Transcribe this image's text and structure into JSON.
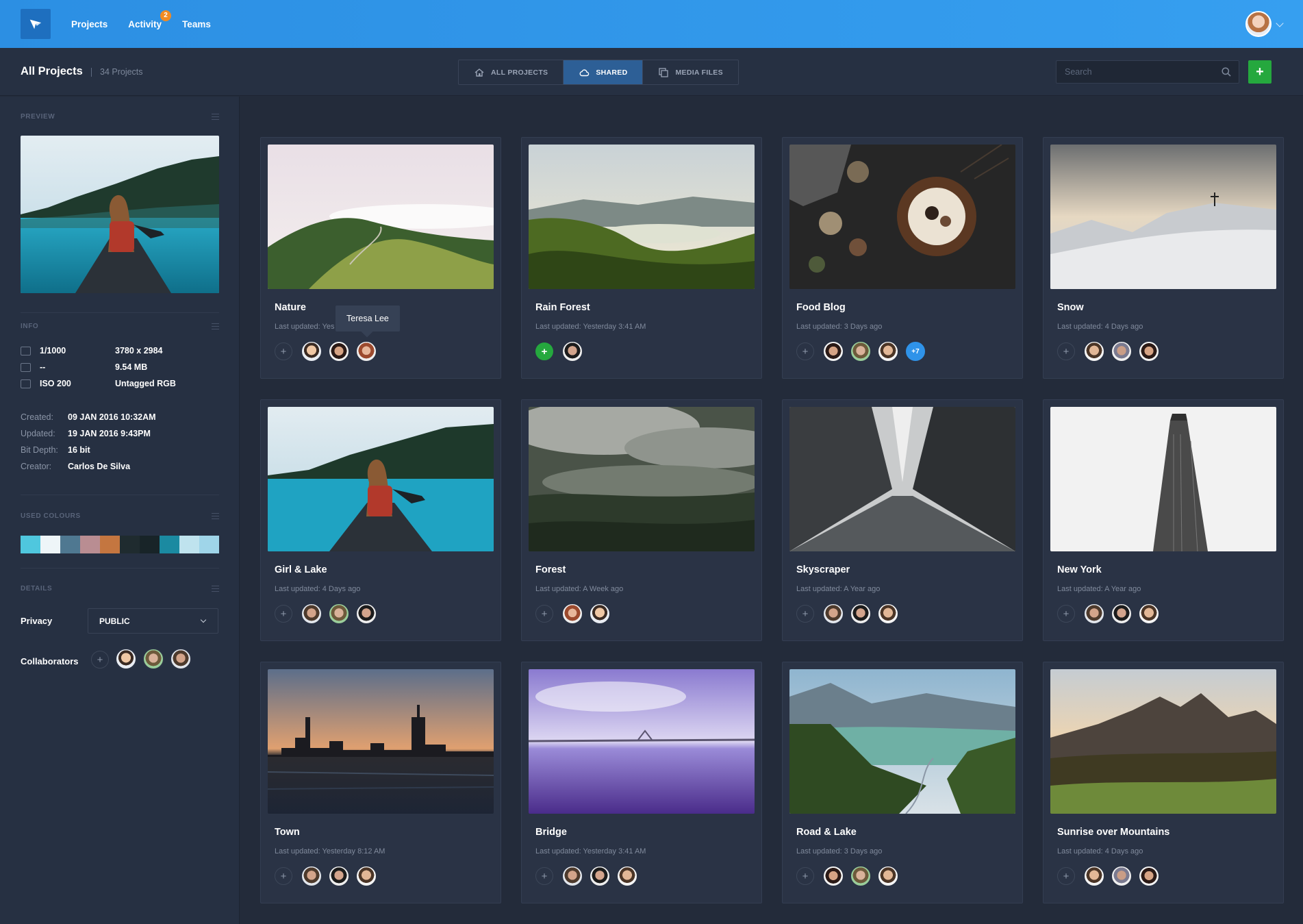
{
  "nav": {
    "items": [
      {
        "label": "Projects",
        "badge": null
      },
      {
        "label": "Activity",
        "badge": "2"
      },
      {
        "label": "Teams",
        "badge": null
      }
    ]
  },
  "header": {
    "title": "All Projects",
    "count": "34 Projects",
    "tabs": [
      {
        "label": "ALL PROJECTS",
        "icon": "home-icon",
        "active": false
      },
      {
        "label": "SHARED",
        "icon": "cloud-icon",
        "active": true
      },
      {
        "label": "MEDIA FILES",
        "icon": "media-files-icon",
        "active": false
      }
    ],
    "search_placeholder": "Search",
    "add_label": "+"
  },
  "sidebar": {
    "preview_heading": "PREVIEW",
    "info_heading": "INFO",
    "info": [
      {
        "icon": "shutter-icon",
        "a": "1/1000",
        "b": "3780 x 2984"
      },
      {
        "icon": "aperture-icon",
        "a": "--",
        "b": "9.54 MB"
      },
      {
        "icon": "iso-icon",
        "a": "ISO 200",
        "b": "Untagged RGB"
      }
    ],
    "meta": [
      {
        "k": "Created:",
        "v": "09 JAN 2016 10:32AM"
      },
      {
        "k": "Updated:",
        "v": "19 JAN 2016 9:43PM"
      },
      {
        "k": "Bit Depth:",
        "v": "16 bit"
      },
      {
        "k": "Creator:",
        "v": "Carlos De Silva"
      }
    ],
    "colours_heading": "USED COLOURS",
    "colours": [
      "#4fc7de",
      "#eef5f8",
      "#4f7891",
      "#b98d92",
      "#c47640",
      "#1f2b2f",
      "#182428",
      "#1b8aa1",
      "#bfe3ee",
      "#9fd5e9"
    ],
    "details_heading": "DETAILS",
    "privacy_label": "Privacy",
    "privacy_value": "PUBLIC",
    "collaborators_label": "Collaborators",
    "collaborator_add": "+"
  },
  "projects": [
    {
      "title": "Nature",
      "updated": "Last updated: Yes",
      "scene": "nature",
      "add": "+",
      "avatars": [
        "av-a",
        "av-b",
        "av-c"
      ],
      "tooltip": "Teresa Lee"
    },
    {
      "title": "Rain Forest",
      "updated": "Last updated: Yesterday 3:41 AM",
      "scene": "rainforest",
      "add": "+",
      "add_green": true,
      "avatars": [
        "av-h"
      ]
    },
    {
      "title": "Food Blog",
      "updated": "Last updated: 3 Days ago",
      "scene": "food",
      "add": "+",
      "avatars": [
        "av-b",
        "av-e",
        "av-f"
      ],
      "more": "+7"
    },
    {
      "title": "Snow",
      "updated": "Last updated: 4 Days ago",
      "scene": "snow",
      "add": "+",
      "avatars": [
        "av-f",
        "av-g",
        "av-b"
      ]
    },
    {
      "title": "Girl & Lake",
      "updated": "Last updated: 4 Days ago",
      "scene": "lake",
      "add": "+",
      "avatars": [
        "av-d",
        "av-e",
        "av-h"
      ]
    },
    {
      "title": "Forest",
      "updated": "Last updated: A Week ago",
      "scene": "forest",
      "add": "+",
      "avatars": [
        "av-c",
        "av-a"
      ]
    },
    {
      "title": "Skyscraper",
      "updated": "Last updated: A Year ago",
      "scene": "skyscraper",
      "add": "+",
      "avatars": [
        "av-d",
        "av-h",
        "av-f"
      ]
    },
    {
      "title": "New York",
      "updated": "Last updated: A Year ago",
      "scene": "newyork",
      "add": "+",
      "avatars": [
        "av-d",
        "av-h",
        "av-f"
      ]
    },
    {
      "title": "Town",
      "updated": "Last updated: Yesterday 8:12 AM",
      "scene": "town",
      "add": "+",
      "avatars": [
        "av-d",
        "av-h",
        "av-f"
      ]
    },
    {
      "title": "Bridge",
      "updated": "Last updated: Yesterday 3:41 AM",
      "scene": "bridge",
      "add": "+",
      "avatars": [
        "av-d",
        "av-h",
        "av-f"
      ]
    },
    {
      "title": "Road & Lake",
      "updated": "Last updated: 3 Days ago",
      "scene": "roadlake",
      "add": "+",
      "avatars": [
        "av-b",
        "av-e",
        "av-f"
      ]
    },
    {
      "title": "Sunrise over Mountains",
      "updated": "Last updated: 4 Days ago",
      "scene": "sunrise",
      "add": "+",
      "avatars": [
        "av-f",
        "av-g",
        "av-b"
      ]
    }
  ]
}
